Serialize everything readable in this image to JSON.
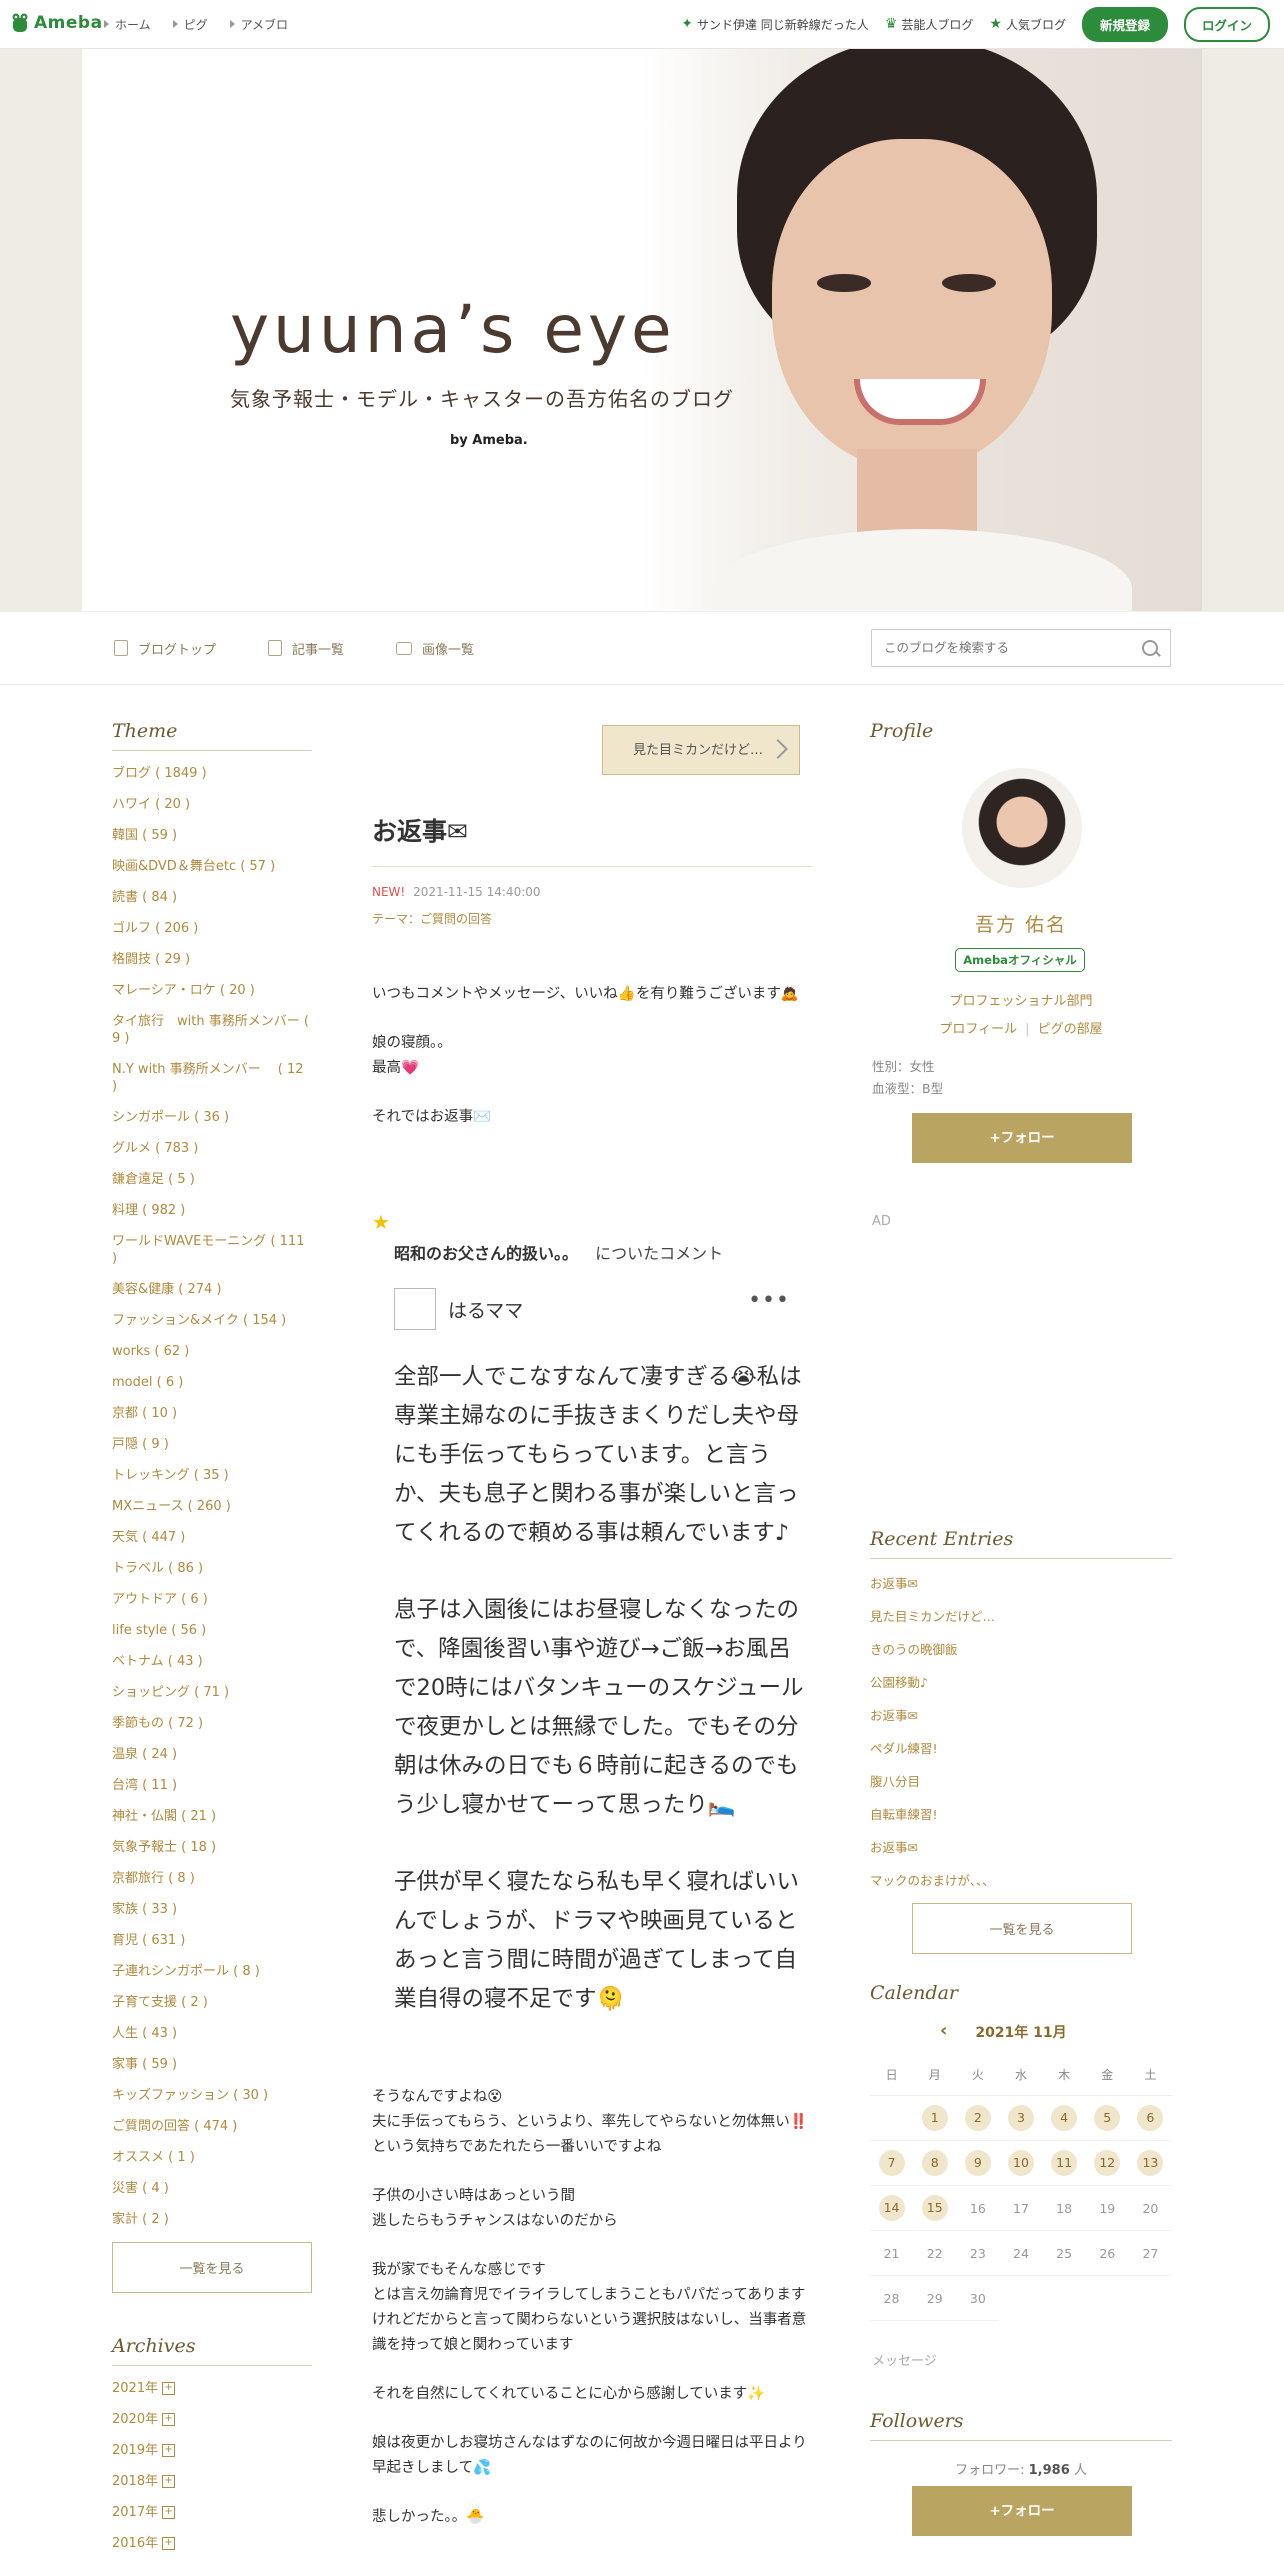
{
  "topbar": {
    "logo_text": "Ameba",
    "nav": [
      "ホーム",
      "ピグ",
      "アメブロ"
    ],
    "right_links": [
      "サンド伊達 同じ新幹線だった人",
      "芸能人ブログ",
      "人気ブログ"
    ],
    "signup_label": "新規登録",
    "login_label": "ログイン"
  },
  "banner": {
    "title": "yuuna’s eye",
    "subtitle": "気象予報士・モデル・キャスターの吾方佑名のブログ",
    "by": "by Ameba."
  },
  "subnav": {
    "links": [
      "ブログトップ",
      "記事一覧",
      "画像一覧"
    ],
    "search_placeholder": "このブログを検索する"
  },
  "left": {
    "theme_title": "Theme",
    "themes": [
      "ブログ ( 1849 )",
      "ハワイ ( 20 )",
      "韓国 ( 59 )",
      "映画&DVD＆舞台etc ( 57 )",
      "読書 ( 84 )",
      "ゴルフ ( 206 )",
      "格闘技 ( 29 )",
      "マレーシア・ロケ ( 20 )",
      "タイ旅行　with 事務所メンバー ( 9 )",
      "N.Y with 事務所メンバー　 ( 12 )",
      "シンガポール ( 36 )",
      "グルメ ( 783 )",
      "鎌倉遠足 ( 5 )",
      "料理 ( 982 )",
      "ワールドWAVEモーニング ( 111 )",
      "美容&健康 ( 274 )",
      "ファッション&メイク ( 154 )",
      "works ( 62 )",
      "model ( 6 )",
      "京都 ( 10 )",
      "戸隠 ( 9 )",
      "トレッキング ( 35 )",
      "MXニュース ( 260 )",
      "天気 ( 447 )",
      "トラベル ( 86 )",
      "アウトドア ( 6 )",
      "life style ( 56 )",
      "ベトナム ( 43 )",
      "ショッピング ( 71 )",
      "季節もの ( 72 )",
      "温泉 ( 24 )",
      "台湾 ( 11 )",
      "神社・仏閣 ( 21 )",
      "気象予報士 ( 18 )",
      "京都旅行 ( 8 )",
      "家族 ( 33 )",
      "育児 ( 631 )",
      "子連れシンガポール ( 8 )",
      "子育て支援 ( 2 )",
      "人生 ( 43 )",
      "家事 ( 59 )",
      "キッズファッション ( 30 )",
      "ご質問の回答 ( 474 )",
      "オススメ ( 1 )",
      "災害 ( 4 )",
      "家計 ( 2 )"
    ],
    "more_label": "一覧を見る",
    "archive_title": "Archives",
    "archives": [
      "2021年",
      "2020年",
      "2019年",
      "2018年",
      "2017年",
      "2016年"
    ]
  },
  "entry": {
    "next_label": "見た目ミカンだけど…",
    "title": "お返事✉",
    "new_label": "NEW!",
    "datetime": "2021-11-15 14:40:00",
    "theme_prefix": "テーマ：",
    "theme": "ご質問の回答",
    "intro": [
      "いつもコメントやメッセージ、いいね👍を有り難うございます🙇",
      "娘の寝顔。。\n最高💗",
      "それではお返事✉️"
    ],
    "quote_subject": "昭和のお父さん的扱い。。",
    "quote_suffix": "についたコメント",
    "commenter": "はるママ",
    "comment": [
      "全部一人でこなすなんて凄すぎる😭私は専業主婦なのに手抜きまくりだし夫や母にも手伝ってもらっています。と言うか、夫も息子と関わる事が楽しいと言ってくれるので頼める事は頼んでいます♪",
      "息子は入園後にはお昼寝しなくなったので、降園後習い事や遊び→ご飯→お風呂で20時にはバタンキューのスケジュールで夜更かしとは無縁でした。でもその分朝は休みの日でも６時前に起きるのでもう少し寝かせてーって思ったり🛌",
      "子供が早く寝たなら私も早く寝ればいいんでしょうが、ドラマや映画見ているとあっと言う間に時間が過ぎてしまって自業自得の寝不足です🫠"
    ],
    "reply": [
      "そうなんですよね😵\n夫に手伝ってもらう、というより、率先してやらないと勿体無い‼️という気持ちであたれたら一番いいですよね",
      "子供の小さい時はあっという間\n逃したらもうチャンスはないのだから",
      "我が家でもそんな感じです\nとは言え勿論育児でイライラしてしまうこともパパだってあります\nけれどだからと言って関わらないという選択肢はないし、当事者意識を持って娘と関わっています",
      "それを自然にしてくれていることに心から感謝しています✨",
      "娘は夜更かしお寝坊さんなはずなのに何故か今週日曜日は平日より早起きしまして💦",
      "悲しかった。。🐣"
    ]
  },
  "right": {
    "profile_title": "Profile",
    "name": "吾方 佑名",
    "badge": "Amebaオフィシャル",
    "link1": "プロフェッショナル部門",
    "link2a": "プロフィール",
    "link2b": "ピグの部屋",
    "gender": "性別：女性",
    "blood": "血液型：B型",
    "follow_label": "+フォロー",
    "ad_label": "AD",
    "recent_title": "Recent Entries",
    "recent": [
      "お返事✉",
      "見た目ミカンだけど…",
      "きのうの晩御飯",
      "公園移動♪",
      "お返事✉",
      "ペダル練習!",
      "腹八分目",
      "自転車練習!",
      "お返事✉",
      "マックのおまけが、、、"
    ],
    "recent_more": "一覧を見る",
    "calendar_title": "Calendar",
    "calendar_month": "2021年 11月",
    "weekdays": [
      "日",
      "月",
      "火",
      "水",
      "木",
      "金",
      "土"
    ],
    "message_label": "メッセージ",
    "followers_title": "Followers",
    "followers_prefix": "フォロワー: ",
    "followers_count": "1,986",
    "followers_suffix": " 人",
    "follow_label2": "+フォロー"
  },
  "colors": {
    "accent_green": "#2d8c3c",
    "gold": "#b08a3e",
    "button_gold": "#b9a462"
  }
}
